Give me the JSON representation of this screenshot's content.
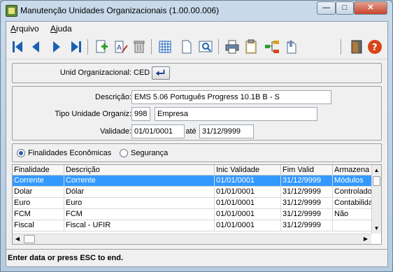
{
  "window": {
    "title": "Manutenção Unidades Organizacionais (1.00.00.006)"
  },
  "menu": {
    "arquivo": "Arquivo",
    "ajuda": "Ajuda"
  },
  "form": {
    "unid_label": "Unid Organizacional:",
    "unid_value": "CED",
    "descricao_label": "Descrição:",
    "descricao_value": "EMS 5.06 Português Progress 10.1B B - S",
    "tipo_label": "Tipo Unidade Organiz:",
    "tipo_code": "998",
    "tipo_desc": "Empresa",
    "validade_label": "Validade:",
    "validade_from": "01/01/0001",
    "ate_label": "até",
    "validade_to": "31/12/9999"
  },
  "radios": {
    "finalidades": "Finalidades Econômicas",
    "seguranca": "Segurança",
    "selected": "finalidades"
  },
  "grid": {
    "columns": [
      "Finalidade",
      "Descrição",
      "Inic Validade",
      "Fim Valid",
      "Armazena"
    ],
    "rows": [
      [
        "Corrente",
        "Corrente",
        "01/01/0001",
        "31/12/9999",
        "Módulos"
      ],
      [
        "Dolar",
        "Dólar",
        "01/01/0001",
        "31/12/9999",
        "Controlado"
      ],
      [
        "Euro",
        "Euro",
        "01/01/0001",
        "31/12/9999",
        "Contabilida"
      ],
      [
        "FCM",
        "FCM",
        "01/01/0001",
        "31/12/9999",
        "Não"
      ],
      [
        "Fiscal",
        "Fiscal - UFIR",
        "01/01/0001",
        "31/12/9999",
        ""
      ]
    ],
    "selected_row": 0
  },
  "status": {
    "text": "Enter data or press ESC to end."
  },
  "toolbar_icons": [
    "first-icon",
    "prev-icon",
    "next-icon",
    "last-icon",
    "add-icon",
    "edit-icon",
    "delete-icon",
    "grid-icon",
    "document-icon",
    "preview-icon",
    "print-icon",
    "clipboard-icon",
    "structure-icon",
    "export-icon",
    "exit-icon",
    "help-icon"
  ],
  "colors": {
    "selection": "#3399ff",
    "nav_blue": "#1a5fb4",
    "help_red": "#d9441c"
  }
}
